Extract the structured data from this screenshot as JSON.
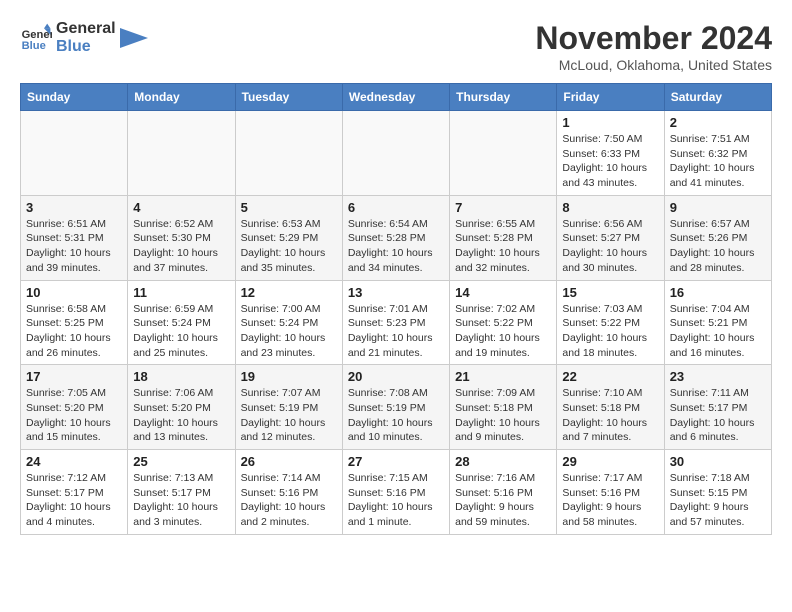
{
  "header": {
    "logo_line1": "General",
    "logo_line2": "Blue",
    "month": "November 2024",
    "location": "McLoud, Oklahoma, United States"
  },
  "weekdays": [
    "Sunday",
    "Monday",
    "Tuesday",
    "Wednesday",
    "Thursday",
    "Friday",
    "Saturday"
  ],
  "weeks": [
    [
      {
        "day": "",
        "info": ""
      },
      {
        "day": "",
        "info": ""
      },
      {
        "day": "",
        "info": ""
      },
      {
        "day": "",
        "info": ""
      },
      {
        "day": "",
        "info": ""
      },
      {
        "day": "1",
        "info": "Sunrise: 7:50 AM\nSunset: 6:33 PM\nDaylight: 10 hours and 43 minutes."
      },
      {
        "day": "2",
        "info": "Sunrise: 7:51 AM\nSunset: 6:32 PM\nDaylight: 10 hours and 41 minutes."
      }
    ],
    [
      {
        "day": "3",
        "info": "Sunrise: 6:51 AM\nSunset: 5:31 PM\nDaylight: 10 hours and 39 minutes."
      },
      {
        "day": "4",
        "info": "Sunrise: 6:52 AM\nSunset: 5:30 PM\nDaylight: 10 hours and 37 minutes."
      },
      {
        "day": "5",
        "info": "Sunrise: 6:53 AM\nSunset: 5:29 PM\nDaylight: 10 hours and 35 minutes."
      },
      {
        "day": "6",
        "info": "Sunrise: 6:54 AM\nSunset: 5:28 PM\nDaylight: 10 hours and 34 minutes."
      },
      {
        "day": "7",
        "info": "Sunrise: 6:55 AM\nSunset: 5:28 PM\nDaylight: 10 hours and 32 minutes."
      },
      {
        "day": "8",
        "info": "Sunrise: 6:56 AM\nSunset: 5:27 PM\nDaylight: 10 hours and 30 minutes."
      },
      {
        "day": "9",
        "info": "Sunrise: 6:57 AM\nSunset: 5:26 PM\nDaylight: 10 hours and 28 minutes."
      }
    ],
    [
      {
        "day": "10",
        "info": "Sunrise: 6:58 AM\nSunset: 5:25 PM\nDaylight: 10 hours and 26 minutes."
      },
      {
        "day": "11",
        "info": "Sunrise: 6:59 AM\nSunset: 5:24 PM\nDaylight: 10 hours and 25 minutes."
      },
      {
        "day": "12",
        "info": "Sunrise: 7:00 AM\nSunset: 5:24 PM\nDaylight: 10 hours and 23 minutes."
      },
      {
        "day": "13",
        "info": "Sunrise: 7:01 AM\nSunset: 5:23 PM\nDaylight: 10 hours and 21 minutes."
      },
      {
        "day": "14",
        "info": "Sunrise: 7:02 AM\nSunset: 5:22 PM\nDaylight: 10 hours and 19 minutes."
      },
      {
        "day": "15",
        "info": "Sunrise: 7:03 AM\nSunset: 5:22 PM\nDaylight: 10 hours and 18 minutes."
      },
      {
        "day": "16",
        "info": "Sunrise: 7:04 AM\nSunset: 5:21 PM\nDaylight: 10 hours and 16 minutes."
      }
    ],
    [
      {
        "day": "17",
        "info": "Sunrise: 7:05 AM\nSunset: 5:20 PM\nDaylight: 10 hours and 15 minutes."
      },
      {
        "day": "18",
        "info": "Sunrise: 7:06 AM\nSunset: 5:20 PM\nDaylight: 10 hours and 13 minutes."
      },
      {
        "day": "19",
        "info": "Sunrise: 7:07 AM\nSunset: 5:19 PM\nDaylight: 10 hours and 12 minutes."
      },
      {
        "day": "20",
        "info": "Sunrise: 7:08 AM\nSunset: 5:19 PM\nDaylight: 10 hours and 10 minutes."
      },
      {
        "day": "21",
        "info": "Sunrise: 7:09 AM\nSunset: 5:18 PM\nDaylight: 10 hours and 9 minutes."
      },
      {
        "day": "22",
        "info": "Sunrise: 7:10 AM\nSunset: 5:18 PM\nDaylight: 10 hours and 7 minutes."
      },
      {
        "day": "23",
        "info": "Sunrise: 7:11 AM\nSunset: 5:17 PM\nDaylight: 10 hours and 6 minutes."
      }
    ],
    [
      {
        "day": "24",
        "info": "Sunrise: 7:12 AM\nSunset: 5:17 PM\nDaylight: 10 hours and 4 minutes."
      },
      {
        "day": "25",
        "info": "Sunrise: 7:13 AM\nSunset: 5:17 PM\nDaylight: 10 hours and 3 minutes."
      },
      {
        "day": "26",
        "info": "Sunrise: 7:14 AM\nSunset: 5:16 PM\nDaylight: 10 hours and 2 minutes."
      },
      {
        "day": "27",
        "info": "Sunrise: 7:15 AM\nSunset: 5:16 PM\nDaylight: 10 hours and 1 minute."
      },
      {
        "day": "28",
        "info": "Sunrise: 7:16 AM\nSunset: 5:16 PM\nDaylight: 9 hours and 59 minutes."
      },
      {
        "day": "29",
        "info": "Sunrise: 7:17 AM\nSunset: 5:16 PM\nDaylight: 9 hours and 58 minutes."
      },
      {
        "day": "30",
        "info": "Sunrise: 7:18 AM\nSunset: 5:15 PM\nDaylight: 9 hours and 57 minutes."
      }
    ]
  ]
}
